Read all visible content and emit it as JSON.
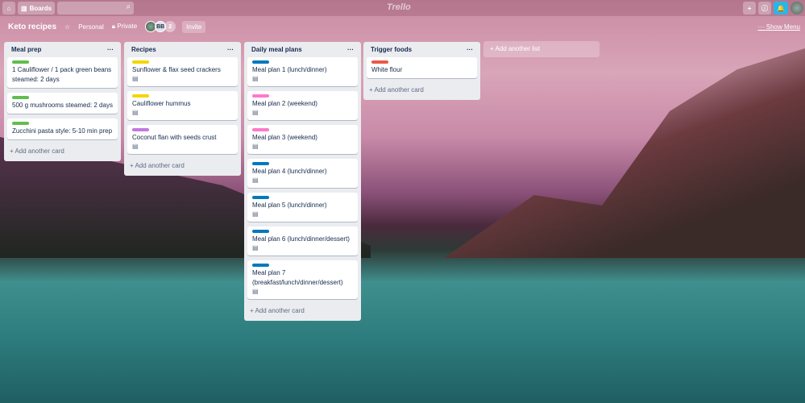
{
  "topbar": {
    "boards_label": "Boards",
    "logo": "Trello",
    "add": "+",
    "info": "ⓘ",
    "notify": "🔔"
  },
  "board": {
    "title": "Keto recipes",
    "team": "Personal",
    "visibility": "Private",
    "member_initials": "BB",
    "member_count": "2",
    "invite": "Invite",
    "show_menu": "Show Menu"
  },
  "lists": [
    {
      "title": "Meal prep",
      "add": "+ Add another card",
      "cards": [
        {
          "text": "1 Cauliflower / 1 pack green beans steamed: 2 days",
          "label": "#61bd4f",
          "desc": false
        },
        {
          "text": "500 g mushrooms steamed: 2 days",
          "label": "#61bd4f",
          "desc": false
        },
        {
          "text": "Zucchini pasta style: 5-10 min prep",
          "label": "#61bd4f",
          "desc": false
        }
      ]
    },
    {
      "title": "Recipes",
      "add": "+ Add another card",
      "cards": [
        {
          "text": "Sunflower & flax seed crackers",
          "label": "#f2d600",
          "desc": true
        },
        {
          "text": "Cauliflower hummus",
          "label": "#f2d600",
          "desc": true
        },
        {
          "text": "Coconut flan with seeds crust",
          "label": "#c377e0",
          "desc": true
        }
      ]
    },
    {
      "title": "Daily meal plans",
      "add": "+ Add another card",
      "cards": [
        {
          "text": "Meal plan 1 (lunch/dinner)",
          "label": "#0079bf",
          "desc": true
        },
        {
          "text": "Meal plan 2 (weekend)",
          "label": "#ff78cb",
          "desc": true
        },
        {
          "text": "Meal plan 3 (weekend)",
          "label": "#ff78cb",
          "desc": true
        },
        {
          "text": "Meal plan 4 (lunch/dinner)",
          "label": "#0079bf",
          "desc": true
        },
        {
          "text": "Meal plan 5 (lunch/dinner)",
          "label": "#0079bf",
          "desc": true
        },
        {
          "text": "Meal plan 6 (lunch/dinner/dessert)",
          "label": "#0079bf",
          "desc": true
        },
        {
          "text": "Meal plan 7 (breakfast/lunch/dinner/dessert)",
          "label": "#0079bf",
          "desc": true
        }
      ]
    },
    {
      "title": "Trigger foods",
      "add": "+ Add another card",
      "cards": [
        {
          "text": "White flour",
          "label": "#eb5a46",
          "desc": false
        }
      ]
    }
  ],
  "add_list": "+ Add another list"
}
